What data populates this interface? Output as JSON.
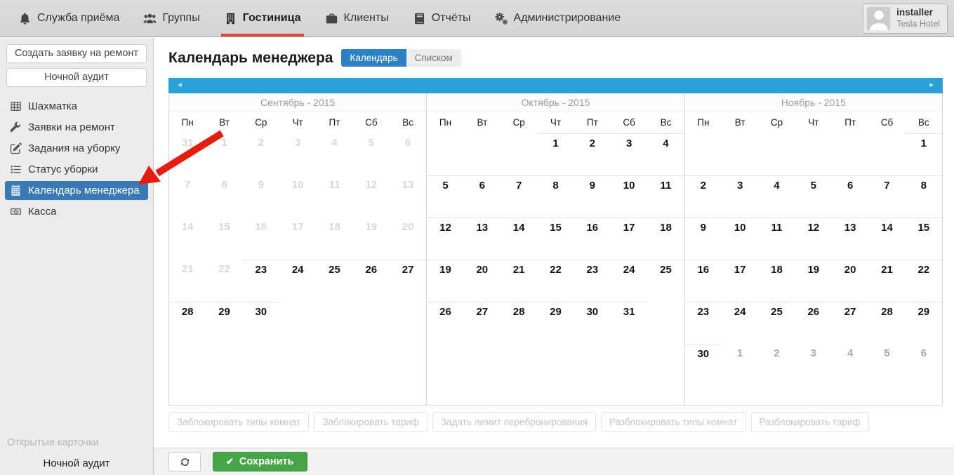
{
  "topnav": {
    "items": [
      {
        "label": "Служба приёма",
        "icon": "bell-icon",
        "active": false
      },
      {
        "label": "Группы",
        "icon": "users-icon",
        "active": false
      },
      {
        "label": "Гостиница",
        "icon": "hotel-icon",
        "active": true
      },
      {
        "label": "Клиенты",
        "icon": "briefcase-icon",
        "active": false
      },
      {
        "label": "Отчёты",
        "icon": "reports-icon",
        "active": false
      },
      {
        "label": "Администрирование",
        "icon": "gears-icon",
        "active": false
      }
    ],
    "user": {
      "name": "installer",
      "org": "Tesla Hotel"
    }
  },
  "sidebar": {
    "buttons": [
      "Создать заявку на ремонт",
      "Ночной аудит"
    ],
    "items": [
      {
        "label": "Шахматка",
        "icon": "grid-icon",
        "active": false
      },
      {
        "label": "Заявки на ремонт",
        "icon": "wrench-icon",
        "active": false
      },
      {
        "label": "Задания на уборку",
        "icon": "edit-icon",
        "active": false
      },
      {
        "label": "Статус уборки",
        "icon": "list-icon",
        "active": false
      },
      {
        "label": "Календарь менеджера",
        "icon": "calendar-icon",
        "active": true
      },
      {
        "label": "Касса",
        "icon": "banknote-icon",
        "active": false
      }
    ],
    "open_cards_label": "Открытые карточки",
    "open_cards": [
      "Ночной аудит"
    ]
  },
  "main": {
    "title": "Календарь менеджера",
    "toggle": [
      {
        "label": "Календарь",
        "active": true
      },
      {
        "label": "Списком",
        "active": false
      }
    ]
  },
  "calendar": {
    "prev": "◄",
    "next": "►",
    "dow": [
      "Пн",
      "Вт",
      "Ср",
      "Чт",
      "Пт",
      "Сб",
      "Вс"
    ],
    "months": [
      {
        "title": "Сентябрь - 2015",
        "weeks": [
          [
            {
              "v": "31",
              "s": "past"
            },
            {
              "v": "1",
              "s": "past"
            },
            {
              "v": "2",
              "s": "past"
            },
            {
              "v": "3",
              "s": "past"
            },
            {
              "v": "4",
              "s": "past"
            },
            {
              "v": "5",
              "s": "past"
            },
            {
              "v": "6",
              "s": "past"
            }
          ],
          [
            {
              "v": "7",
              "s": "past"
            },
            {
              "v": "8",
              "s": "past"
            },
            {
              "v": "9",
              "s": "past"
            },
            {
              "v": "10",
              "s": "past"
            },
            {
              "v": "11",
              "s": "past"
            },
            {
              "v": "12",
              "s": "past"
            },
            {
              "v": "13",
              "s": "past"
            }
          ],
          [
            {
              "v": "14",
              "s": "past"
            },
            {
              "v": "15",
              "s": "past"
            },
            {
              "v": "16",
              "s": "past"
            },
            {
              "v": "17",
              "s": "past"
            },
            {
              "v": "18",
              "s": "past"
            },
            {
              "v": "19",
              "s": "past"
            },
            {
              "v": "20",
              "s": "past"
            }
          ],
          [
            {
              "v": "21",
              "s": "past"
            },
            {
              "v": "22",
              "s": "past"
            },
            {
              "v": "23",
              "s": "active"
            },
            {
              "v": "24",
              "s": "active"
            },
            {
              "v": "25",
              "s": "active"
            },
            {
              "v": "26",
              "s": "active"
            },
            {
              "v": "27",
              "s": "active"
            }
          ],
          [
            {
              "v": "28",
              "s": "active"
            },
            {
              "v": "29",
              "s": "active"
            },
            {
              "v": "30",
              "s": "active"
            },
            null,
            null,
            null,
            null
          ],
          [
            null,
            null,
            null,
            null,
            null,
            null,
            null
          ]
        ]
      },
      {
        "title": "Октябрь - 2015",
        "weeks": [
          [
            null,
            null,
            null,
            {
              "v": "1",
              "s": "active"
            },
            {
              "v": "2",
              "s": "active"
            },
            {
              "v": "3",
              "s": "active"
            },
            {
              "v": "4",
              "s": "active"
            }
          ],
          [
            {
              "v": "5",
              "s": "active"
            },
            {
              "v": "6",
              "s": "active"
            },
            {
              "v": "7",
              "s": "active"
            },
            {
              "v": "8",
              "s": "active"
            },
            {
              "v": "9",
              "s": "active"
            },
            {
              "v": "10",
              "s": "active"
            },
            {
              "v": "11",
              "s": "active"
            }
          ],
          [
            {
              "v": "12",
              "s": "active"
            },
            {
              "v": "13",
              "s": "active"
            },
            {
              "v": "14",
              "s": "active"
            },
            {
              "v": "15",
              "s": "active"
            },
            {
              "v": "16",
              "s": "active"
            },
            {
              "v": "17",
              "s": "active"
            },
            {
              "v": "18",
              "s": "active"
            }
          ],
          [
            {
              "v": "19",
              "s": "active"
            },
            {
              "v": "20",
              "s": "active"
            },
            {
              "v": "21",
              "s": "active"
            },
            {
              "v": "22",
              "s": "active"
            },
            {
              "v": "23",
              "s": "active"
            },
            {
              "v": "24",
              "s": "active"
            },
            {
              "v": "25",
              "s": "active"
            }
          ],
          [
            {
              "v": "26",
              "s": "active"
            },
            {
              "v": "27",
              "s": "active"
            },
            {
              "v": "28",
              "s": "active"
            },
            {
              "v": "29",
              "s": "active"
            },
            {
              "v": "30",
              "s": "active"
            },
            {
              "v": "31",
              "s": "active"
            },
            null
          ],
          [
            null,
            null,
            null,
            null,
            null,
            null,
            null
          ]
        ]
      },
      {
        "title": "Ноябрь - 2015",
        "weeks": [
          [
            null,
            null,
            null,
            null,
            null,
            null,
            {
              "v": "1",
              "s": "active"
            }
          ],
          [
            {
              "v": "2",
              "s": "active"
            },
            {
              "v": "3",
              "s": "active"
            },
            {
              "v": "4",
              "s": "active"
            },
            {
              "v": "5",
              "s": "active"
            },
            {
              "v": "6",
              "s": "active"
            },
            {
              "v": "7",
              "s": "active"
            },
            {
              "v": "8",
              "s": "active"
            }
          ],
          [
            {
              "v": "9",
              "s": "active"
            },
            {
              "v": "10",
              "s": "active"
            },
            {
              "v": "11",
              "s": "active"
            },
            {
              "v": "12",
              "s": "active"
            },
            {
              "v": "13",
              "s": "active"
            },
            {
              "v": "14",
              "s": "active"
            },
            {
              "v": "15",
              "s": "active"
            }
          ],
          [
            {
              "v": "16",
              "s": "active"
            },
            {
              "v": "17",
              "s": "active"
            },
            {
              "v": "18",
              "s": "active"
            },
            {
              "v": "19",
              "s": "active"
            },
            {
              "v": "20",
              "s": "active"
            },
            {
              "v": "21",
              "s": "active"
            },
            {
              "v": "22",
              "s": "active"
            }
          ],
          [
            {
              "v": "23",
              "s": "active"
            },
            {
              "v": "24",
              "s": "active"
            },
            {
              "v": "25",
              "s": "active"
            },
            {
              "v": "26",
              "s": "active"
            },
            {
              "v": "27",
              "s": "active"
            },
            {
              "v": "28",
              "s": "active"
            },
            {
              "v": "29",
              "s": "active"
            }
          ],
          [
            {
              "v": "30",
              "s": "active"
            },
            {
              "v": "1",
              "s": "next"
            },
            {
              "v": "2",
              "s": "next"
            },
            {
              "v": "3",
              "s": "next"
            },
            {
              "v": "4",
              "s": "next"
            },
            {
              "v": "5",
              "s": "next"
            },
            {
              "v": "6",
              "s": "next"
            }
          ]
        ]
      }
    ]
  },
  "actions": [
    "Заблокировать типы комнат",
    "Заблокировать тариф",
    "Задать лимит перебронирования",
    "Разблокировать типы комнат",
    "Разблокировать тариф"
  ],
  "footer": {
    "save_label": "Сохранить",
    "save_check": "✔"
  },
  "colors": {
    "accent_blue": "#2aa0d9",
    "selected_blue": "#3b78b6",
    "toggle_blue": "#2e80c4",
    "active_tab_red": "#e2473a",
    "save_green": "#46a546",
    "arrow_red": "#e51d0e"
  }
}
